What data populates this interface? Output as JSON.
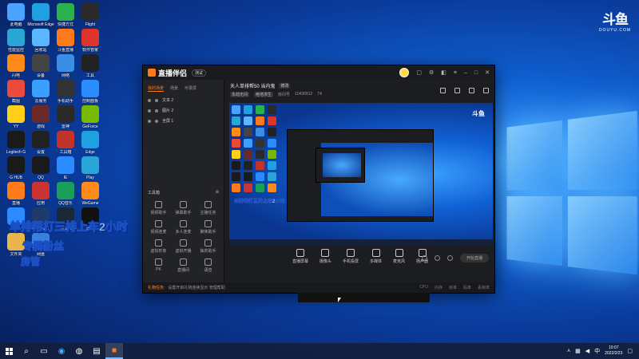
{
  "watermark": {
    "mark": "斗鱼",
    "text": "DOUYU.COM"
  },
  "desktop_icons": [
    {
      "label": "此电脑",
      "color": "#4aa3ff"
    },
    {
      "label": "Microsoft Edge",
      "color": "#1fa0e0"
    },
    {
      "label": "快捷方式",
      "color": "#2bb24c"
    },
    {
      "label": "Flight",
      "color": "#2a2a2a"
    },
    {
      "label": "性能监控",
      "color": "#2aa6d6"
    },
    {
      "label": "回收站",
      "color": "#5ab6ff"
    },
    {
      "label": "斗鱼直播",
      "color": "#ff7a1a"
    },
    {
      "label": "软件管家",
      "color": "#e0332a"
    },
    {
      "label": "闪电",
      "color": "#ff8a1a"
    },
    {
      "label": "设备",
      "color": "#444"
    },
    {
      "label": "网络",
      "color": "#3a8ee6"
    },
    {
      "label": "工具",
      "color": "#222"
    },
    {
      "label": "截图",
      "color": "#e84b3c"
    },
    {
      "label": "云服务",
      "color": "#3aa0ff"
    },
    {
      "label": "手机助手",
      "color": "#333"
    },
    {
      "label": "控制面板",
      "color": "#2a8cff"
    },
    {
      "label": "YY",
      "color": "#ffcf1a"
    },
    {
      "label": "游戏",
      "color": "#6a2a2a"
    },
    {
      "label": "雷神",
      "color": "#2a2a2a"
    },
    {
      "label": "GeForce",
      "color": "#76b900"
    },
    {
      "label": "Logitech G",
      "color": "#1a1a1a"
    },
    {
      "label": "设置",
      "color": "#222"
    },
    {
      "label": "工具箱",
      "color": "#c0342a"
    },
    {
      "label": "Edge",
      "color": "#1fa0e0"
    },
    {
      "label": "G HUB",
      "color": "#1a1a1a"
    },
    {
      "label": "QQ",
      "color": "#1a1a1a"
    },
    {
      "label": "IE",
      "color": "#2a8cff"
    },
    {
      "label": "Play",
      "color": "#2aa6d6"
    },
    {
      "label": "直播",
      "color": "#ff7a1a"
    },
    {
      "label": "应用",
      "color": "#cc3333"
    },
    {
      "label": "QQ音乐",
      "color": "#1a9e5a"
    },
    {
      "label": "WeGame",
      "color": "#ff8a1a"
    },
    {
      "label": "助手",
      "color": "#2a8cff"
    },
    {
      "label": "wallpaper",
      "color": "#1d3a6a"
    },
    {
      "label": "steam",
      "color": "#1b2838"
    },
    {
      "label": "剪映",
      "color": "#111"
    },
    {
      "label": "文件夹",
      "color": "#e8b64a"
    },
    {
      "label": "网盘",
      "color": "#3a7fe0"
    }
  ],
  "banner": {
    "line1": "单排帮打三排上车2小时",
    "line2": "专属粉丝",
    "line3": "房管"
  },
  "app": {
    "name": "直播伴侣",
    "beta": "测试",
    "tabs": [
      "我的场景",
      "场景",
      "可录屏"
    ],
    "scenes": [
      "文本 2",
      "图片 2",
      "全屏 1"
    ],
    "tools_title": "工具箱",
    "tools": [
      "视频助手",
      "弹幕助手",
      "主播任务",
      "视频连麦",
      "多人连麦",
      "聚焦助手",
      "虚拟形象",
      "虚拟开播",
      "抽奖助手",
      "PK",
      "直播间",
      "语音"
    ],
    "room_title": "天人单排帮50 当内鬼",
    "room_tag": "修改",
    "room_meta": [
      "永劫无间",
      "绝地求生",
      "房间号",
      "10436812",
      "74"
    ],
    "douyu_small": "斗鱼",
    "banner_small": "单排帮打三排上车2小时",
    "controls": [
      "直播屏幕",
      "摄像头",
      "手机投屏",
      "多媒体",
      "麦克风",
      "扬声器"
    ],
    "golive": "开始直播",
    "status_alert": "礼物任务:",
    "status_text": "设置开启礼物连续显示 管理帮助",
    "status_stats": [
      "CPU",
      "内存",
      "帧率",
      "码率",
      "丢帧率"
    ]
  },
  "taskbar": {
    "time": "10:07",
    "date": "2022/2/23",
    "tray_text": "中"
  }
}
